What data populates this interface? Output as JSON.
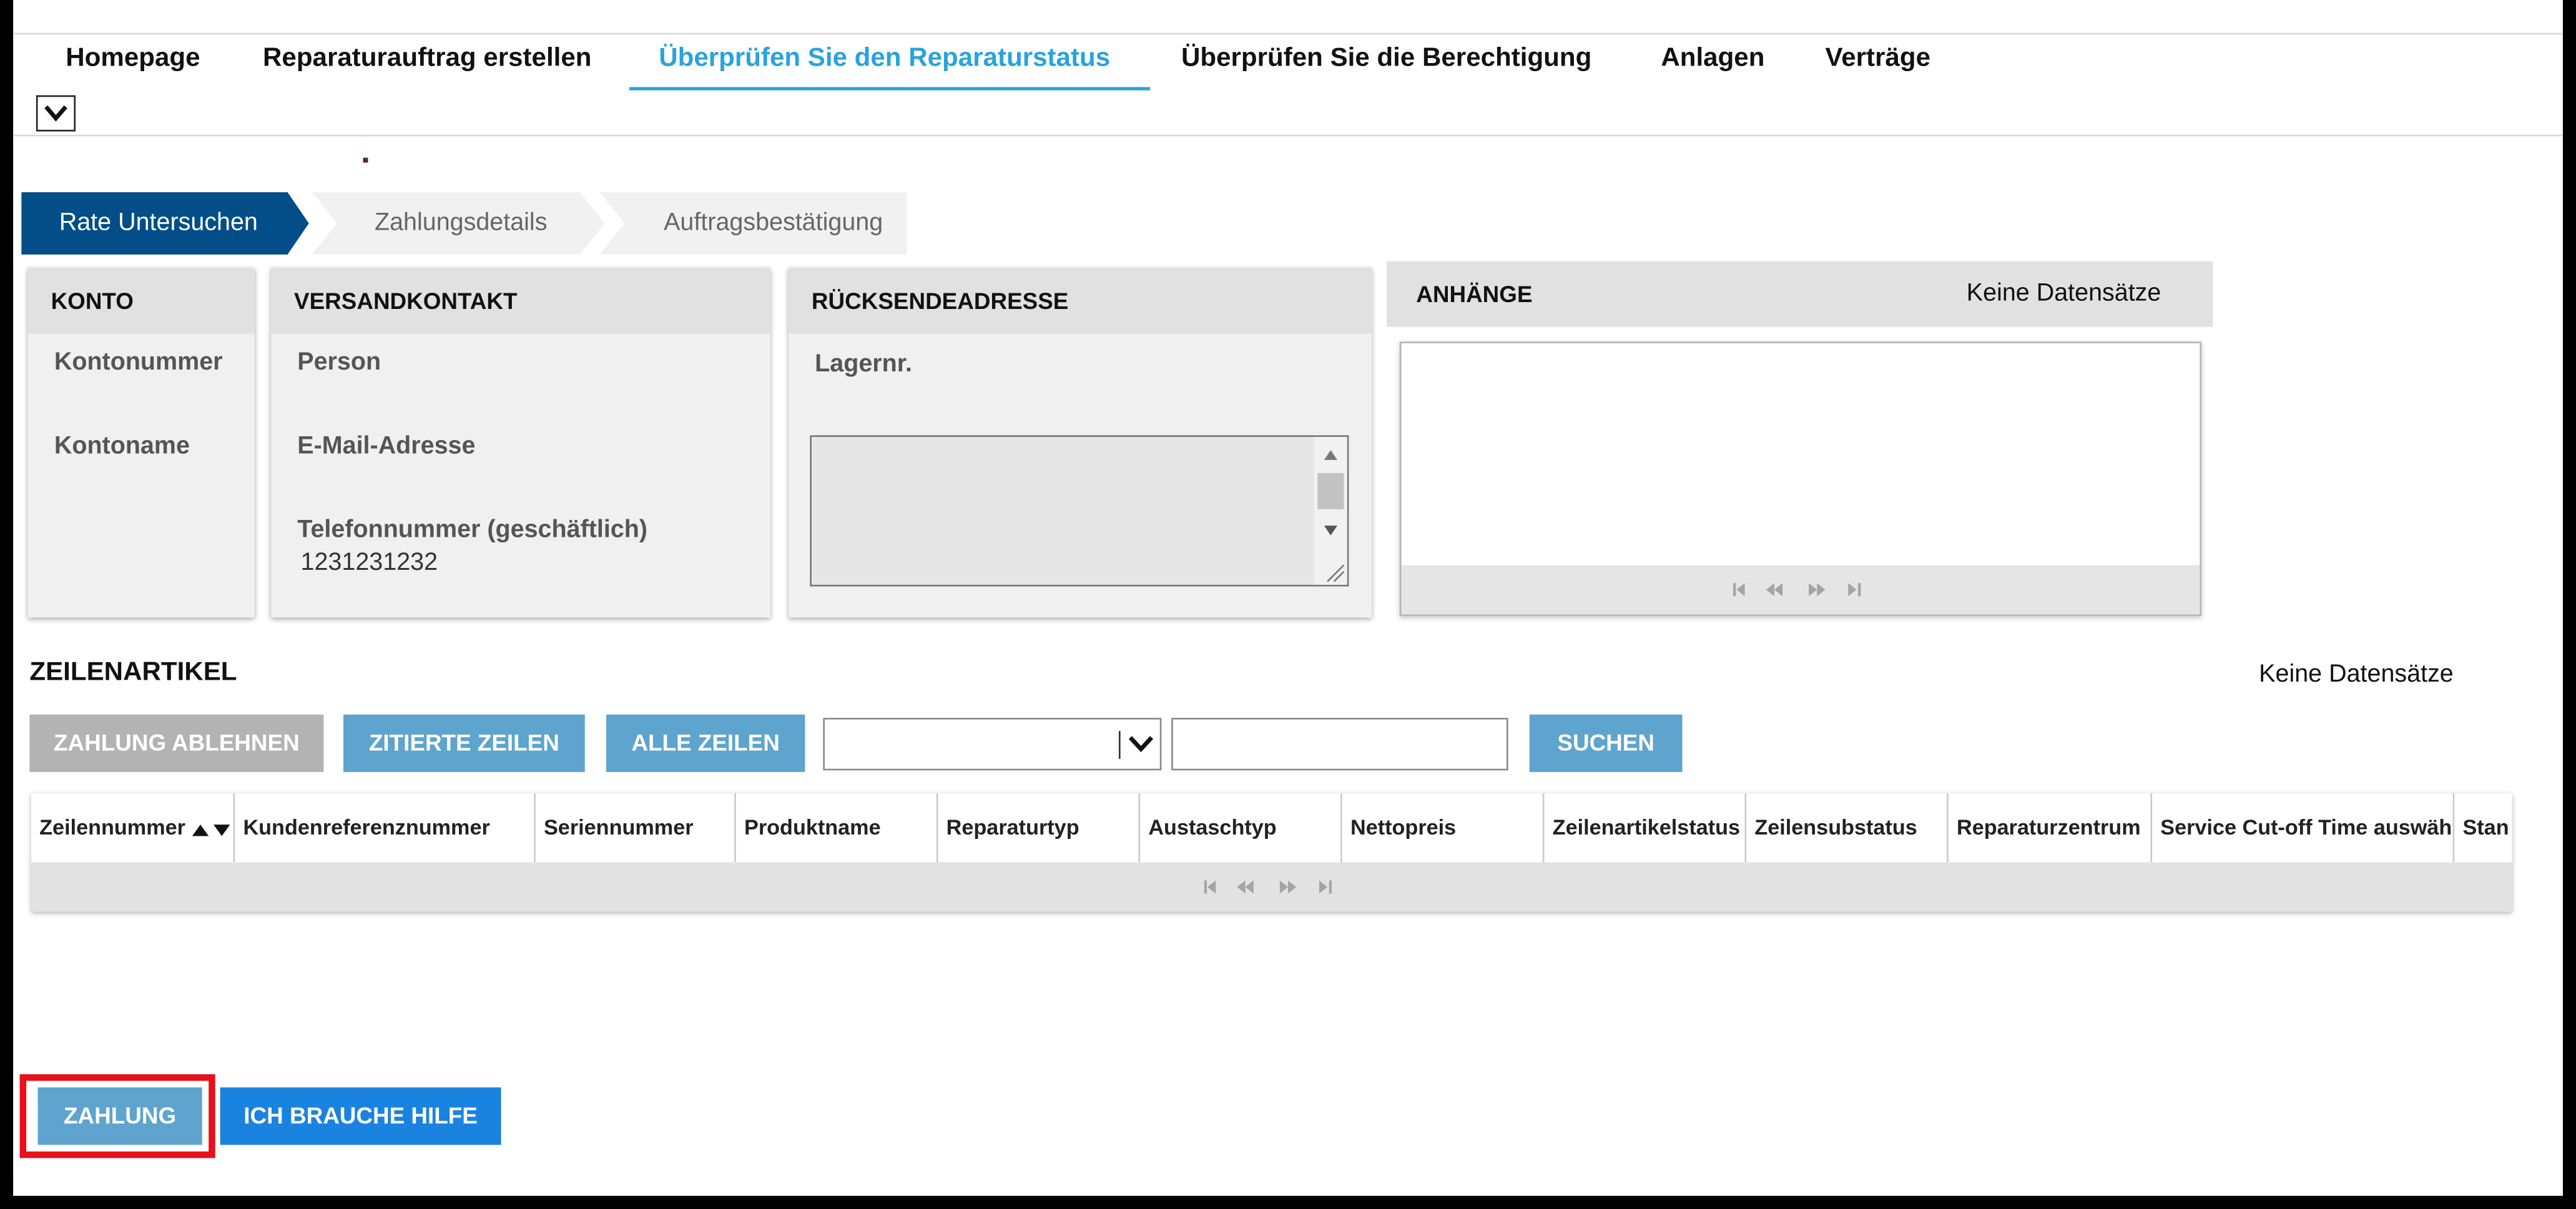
{
  "nav": {
    "items": [
      {
        "label": "Homepage"
      },
      {
        "label": "Reparaturauftrag erstellen"
      },
      {
        "label": "Überprüfen Sie den Reparaturstatus",
        "active": true
      },
      {
        "label": "Überprüfen Sie die Berechtigung"
      },
      {
        "label": "Anlagen"
      },
      {
        "label": "Verträge"
      }
    ],
    "toggle_icon": "chevron-down-icon"
  },
  "steps": [
    {
      "label": "Rate Untersuchen",
      "state": "active"
    },
    {
      "label": "Zahlungsdetails",
      "state": "pending"
    },
    {
      "label": "Auftragsbestätigung",
      "state": "pending"
    }
  ],
  "account": {
    "title": "KONTO",
    "number_label": "Kontonummer",
    "name_label": "Kontoname"
  },
  "shipping_contact": {
    "title": "VERSANDKONTAKT",
    "person_label": "Person",
    "email_label": "E-Mail-Adresse",
    "phone_label": "Telefonnummer (geschäftlich)",
    "phone_value": "1231231232"
  },
  "return_address": {
    "title": "RÜCKSENDEADRESSE",
    "warehouse_label": "Lagernr."
  },
  "attachments": {
    "title": "ANHÄNGE",
    "empty_text": "Keine Datensätze"
  },
  "line_items": {
    "title": "ZEILENARTIKEL",
    "empty_text": "Keine Datensätze",
    "buttons": {
      "reject": "ZAHLUNG ABLEHNEN",
      "quoted": "ZITIERTE ZEILEN",
      "all": "ALLE ZEILEN",
      "search": "SUCHEN"
    },
    "search_value": "",
    "filter_value": "",
    "columns": [
      "Zeilennummer",
      "Kundenreferenznummer",
      "Seriennummer",
      "Produktname",
      "Reparaturtyp",
      "Austaschtyp",
      "Nettopreis",
      "Zeilenartikelstatus",
      "Zeilensubstatus",
      "Reparaturzentrum",
      "Service Cut-off Time auswähl",
      "Stan"
    ],
    "sorted_column": "Zeilennummer"
  },
  "footer": {
    "pay_button": "ZAHLUNG",
    "help_button": "ICH BRAUCHE HILFE"
  },
  "colors": {
    "nav_active": "#29a3dc",
    "step_active": "#034e88",
    "button_blue": "#5ea4ce",
    "button_bright": "#1a83e0",
    "highlight": "#e8101a"
  }
}
